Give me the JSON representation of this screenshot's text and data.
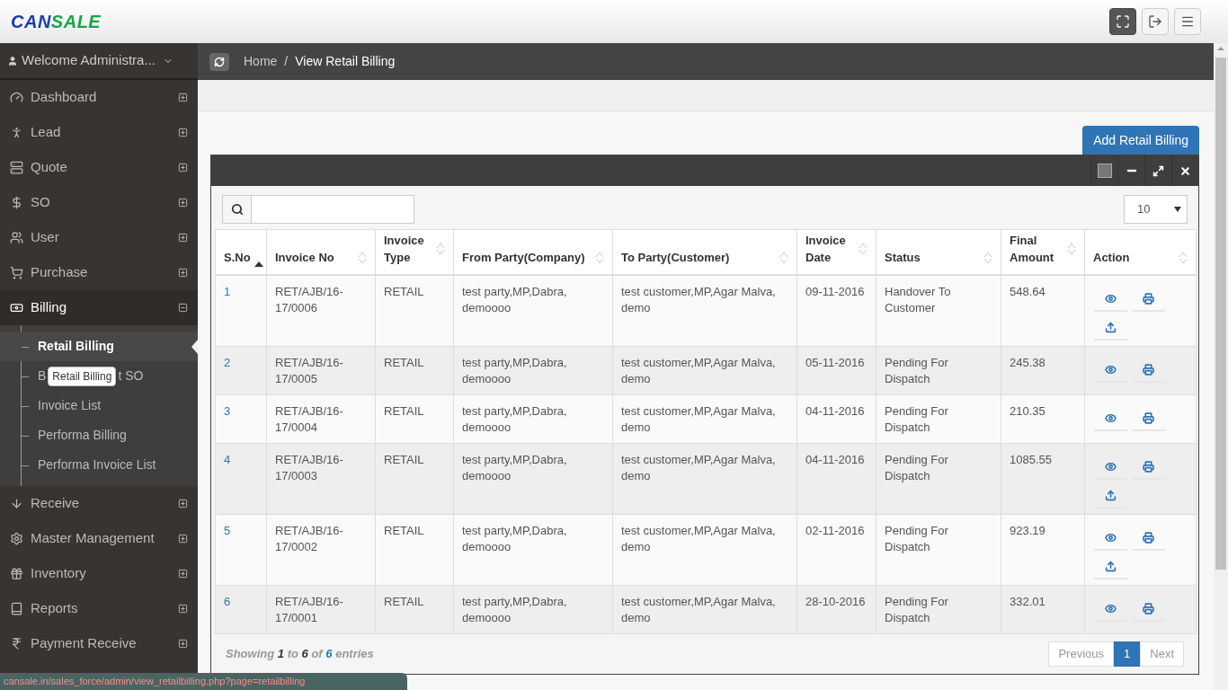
{
  "header": {
    "logo": {
      "part1": "CAN",
      "part2": "SALE"
    },
    "buttons": [
      {
        "kind": "fullscreen",
        "selected": true
      },
      {
        "kind": "logout",
        "selected": false
      },
      {
        "kind": "menu",
        "selected": false
      }
    ]
  },
  "sidebar": {
    "user": "Welcome Administra...",
    "items": [
      {
        "label": "Dashboard",
        "expanded": false
      },
      {
        "label": "Lead",
        "expanded": false
      },
      {
        "label": "Quote",
        "expanded": false
      },
      {
        "label": "SO",
        "expanded": false
      },
      {
        "label": "User",
        "expanded": false
      },
      {
        "label": "Purchase",
        "expanded": false
      },
      {
        "label": "Billing",
        "expanded": true,
        "children": [
          {
            "label": "Retail Billing",
            "selected": true
          },
          {
            "label_start": "B",
            "label_end": "t SO",
            "tooltip": "Retail Billing",
            "selected": false
          },
          {
            "label": "Invoice List",
            "selected": false
          },
          {
            "label": "Performa Billing",
            "selected": false
          },
          {
            "label": "Performa Invoice List",
            "selected": false
          }
        ]
      },
      {
        "label": "Receive",
        "expanded": false
      },
      {
        "label": "Master Management",
        "expanded": false
      },
      {
        "label": "Inventory",
        "expanded": false
      },
      {
        "label": "Reports",
        "expanded": false
      },
      {
        "label": "Payment Receive",
        "expanded": false
      }
    ]
  },
  "breadcrumb": {
    "home": "Home",
    "separator": "/",
    "current": "View Retail Billing"
  },
  "add_button": "Add Retail Billing",
  "table": {
    "page_size": "10",
    "columns": [
      {
        "label": "S.No",
        "sorted": true
      },
      {
        "label": "Invoice No",
        "sorted": false
      },
      {
        "label": "Invoice Type",
        "sorted": false
      },
      {
        "label": "From Party(Company)",
        "sorted": false
      },
      {
        "label": "To Party(Customer)",
        "sorted": false
      },
      {
        "label": "Invoice Date",
        "sorted": false
      },
      {
        "label": "Status",
        "sorted": false
      },
      {
        "label": "Final Amount",
        "sorted": false
      },
      {
        "label": "Action",
        "sorted": false
      }
    ],
    "rows": [
      {
        "cells": [
          "1",
          "RET/AJB/16-17/0006",
          "RETAIL",
          "test party,MP,Dabra, demoooo",
          "test customer,MP,Agar Malva, demo",
          "09-11-2016",
          "Handover To Customer",
          "548.64"
        ],
        "actions": [
          {
            "kind": "view"
          },
          {
            "kind": "print"
          },
          {
            "kind": "upload"
          }
        ]
      },
      {
        "cells": [
          "2",
          "RET/AJB/16-17/0005",
          "RETAIL",
          "test party,MP,Dabra, demoooo",
          "test customer,MP,Agar Malva, demo",
          "05-11-2016",
          "Pending For Dispatch",
          "245.38"
        ],
        "actions": [
          {
            "kind": "view"
          },
          {
            "kind": "print"
          }
        ]
      },
      {
        "cells": [
          "3",
          "RET/AJB/16-17/0004",
          "RETAIL",
          "test party,MP,Dabra, demoooo",
          "test customer,MP,Agar Malva, demo",
          "04-11-2016",
          "Pending For Dispatch",
          "210.35"
        ],
        "actions": [
          {
            "kind": "view"
          },
          {
            "kind": "print"
          }
        ]
      },
      {
        "cells": [
          "4",
          "RET/AJB/16-17/0003",
          "RETAIL",
          "test party,MP,Dabra, demoooo",
          "test customer,MP,Agar Malva, demo",
          "04-11-2016",
          "Pending For Dispatch",
          "1085.55"
        ],
        "actions": [
          {
            "kind": "view"
          },
          {
            "kind": "print"
          },
          {
            "kind": "upload"
          }
        ]
      },
      {
        "cells": [
          "5",
          "RET/AJB/16-17/0002",
          "RETAIL",
          "test party,MP,Dabra, demoooo",
          "test customer,MP,Agar Malva, demo",
          "02-11-2016",
          "Pending For Dispatch",
          "923.19"
        ],
        "actions": [
          {
            "kind": "view"
          },
          {
            "kind": "print"
          },
          {
            "kind": "upload"
          }
        ]
      },
      {
        "cells": [
          "6",
          "RET/AJB/16-17/0001",
          "RETAIL",
          "test party,MP,Dabra, demoooo",
          "test customer,MP,Agar Malva, demo",
          "28-10-2016",
          "Pending For Dispatch",
          "332.01"
        ],
        "actions": [
          {
            "kind": "view"
          },
          {
            "kind": "print"
          }
        ]
      }
    ],
    "info": {
      "prefix": "Showing",
      "from": "1",
      "to_word": "to",
      "to": "6",
      "of_word": "of",
      "total": "6",
      "suffix": "entries"
    },
    "pagination": [
      {
        "label": "Previous",
        "selected": false
      },
      {
        "label": "1",
        "selected": true
      },
      {
        "label": "Next",
        "selected": false
      }
    ]
  },
  "status_bar": "cansale.in/sales_force/admin/view_retailbilling.php?page=retailbilling"
}
